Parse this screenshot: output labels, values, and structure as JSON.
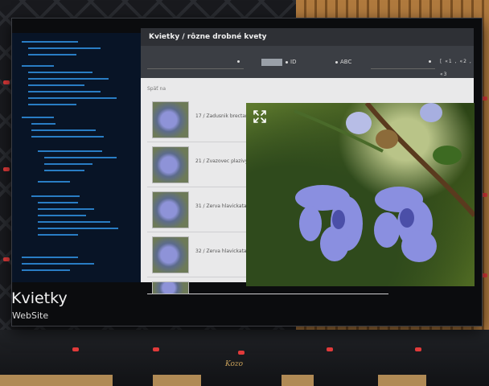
{
  "page": {
    "caption_title": "Kvietky",
    "caption_subtitle": "WebSite",
    "floor_label": "Kozo"
  },
  "site": {
    "header_title": "Kvietky / rôzne drobné kvety",
    "toolbar": {
      "id_label": "ID",
      "abc_label": "ABC",
      "pager_label": "[ «1 , «2 , «3"
    },
    "back_label": "Späť na",
    "rows": [
      {
        "caption": "17 /  Zadusnik brectanoly"
      },
      {
        "caption": "21 /  Zvazovec plazivy"
      },
      {
        "caption": "31 /  Zerva hlavickata"
      },
      {
        "caption": "32 /  Zerva hlavickata"
      },
      {
        "caption": ""
      }
    ]
  },
  "viewer": {
    "expand_icon": "expand-arrows-icon"
  },
  "colors": {
    "accent_blue": "#2f8fe0",
    "peg_red": "#e23b3b",
    "wood": "#b07a3e"
  }
}
